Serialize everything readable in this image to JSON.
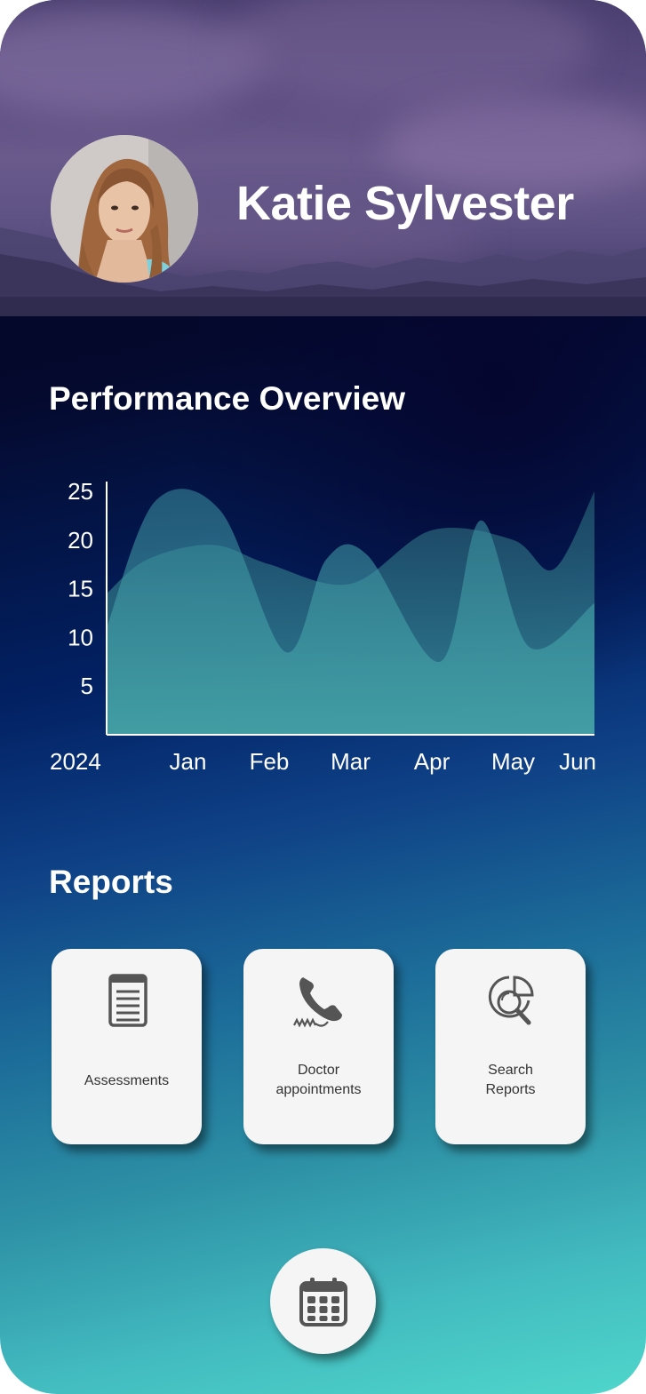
{
  "profile": {
    "name": "Katie Sylvester",
    "avatar_icon": "user-photo"
  },
  "performance": {
    "title": "Performance Overview"
  },
  "chart_data": {
    "type": "area",
    "x_tick_labels": [
      "2024",
      "Jan",
      "Feb",
      "Mar",
      "Apr",
      "May",
      "Jun"
    ],
    "y_tick_labels": [
      "25",
      "20",
      "15",
      "10",
      "5"
    ],
    "ylim": [
      0,
      26
    ],
    "grid": false,
    "series": [
      {
        "x": [
          0,
          0.5,
          1.3,
          2,
          3,
          4,
          5,
          5.5,
          6
        ],
        "values": [
          14.5,
          18,
          19.5,
          17.5,
          15.5,
          21,
          20,
          17,
          25
        ],
        "color": "#2f7f8a"
      },
      {
        "x": [
          0,
          0.6,
          1.4,
          2.2,
          2.7,
          3.2,
          4.1,
          4.6,
          5.2,
          6
        ],
        "values": [
          11,
          24,
          23,
          8.5,
          18,
          18.5,
          7.5,
          22,
          9,
          13.5
        ],
        "color": "#3a97a0"
      }
    ]
  },
  "reports": {
    "title": "Reports",
    "cards": [
      {
        "label": "Assessments",
        "icon": "document-icon"
      },
      {
        "label": "Doctor\nappointments",
        "icon": "phone-icon"
      },
      {
        "label": "Search\nReports",
        "icon": "search-report-icon"
      }
    ]
  },
  "fab": {
    "icon": "calendar-icon"
  }
}
